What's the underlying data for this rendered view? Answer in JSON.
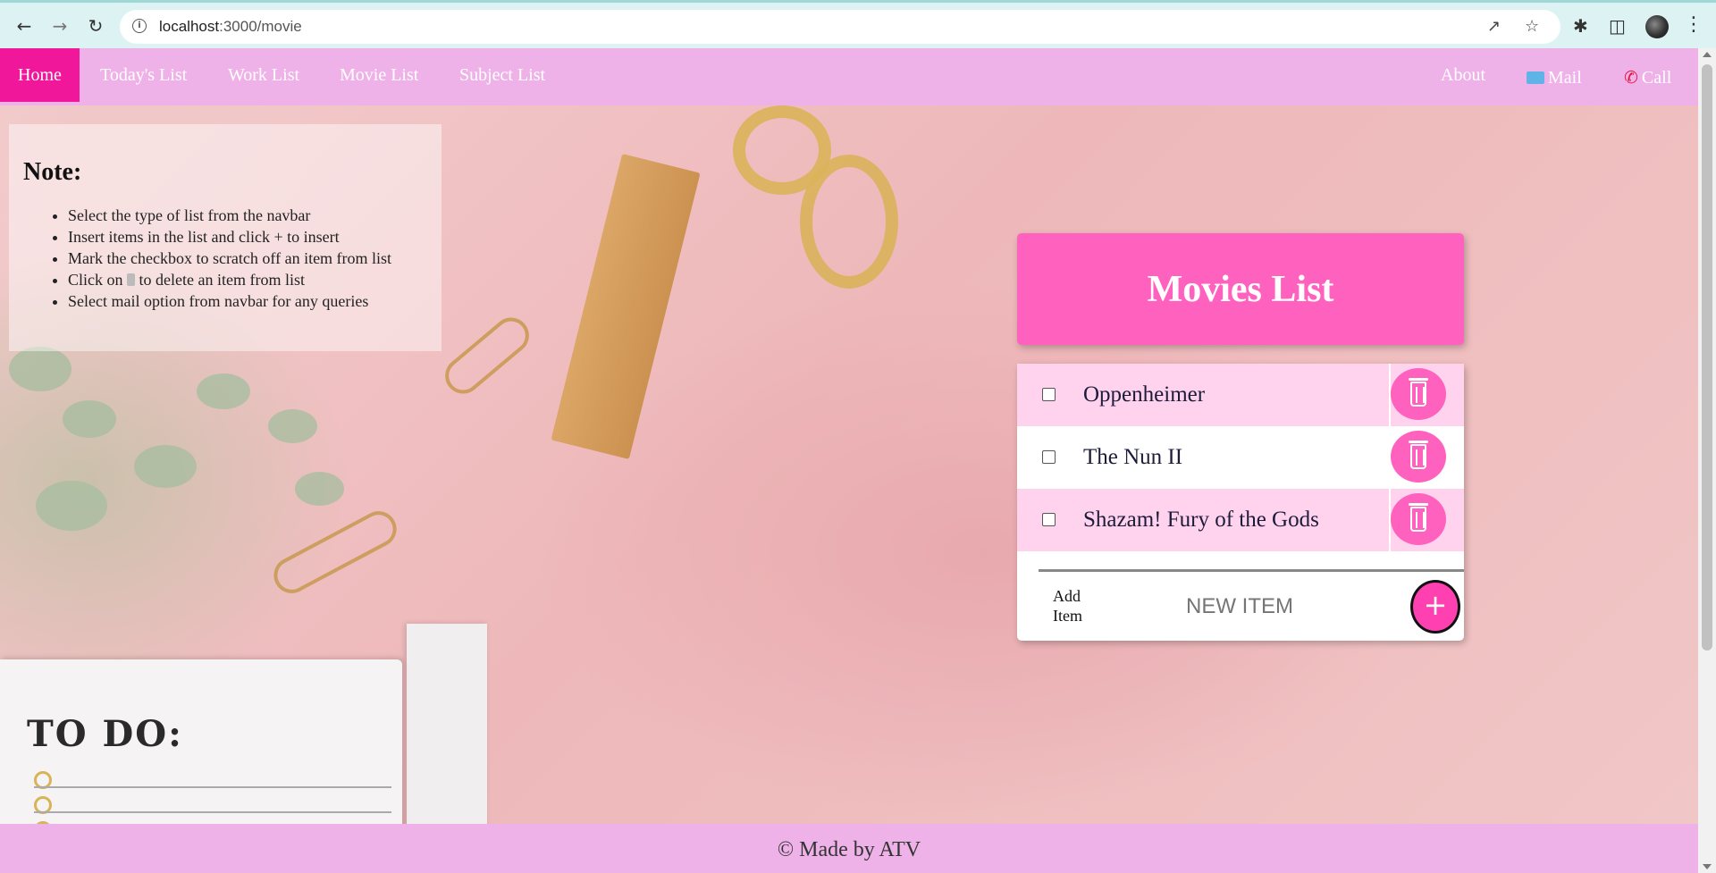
{
  "browser": {
    "url_host": "localhost",
    "url_path": ":3000/movie"
  },
  "navbar": {
    "home": "Home",
    "todays_list": "Today's List",
    "work_list": "Work List",
    "movie_list": "Movie List",
    "subject_list": "Subject List",
    "about": "About",
    "mail": "Mail",
    "call": "Call"
  },
  "note": {
    "title": "Note:",
    "items": [
      "Select the type of list from the navbar",
      "Insert items in the list and click + to insert",
      "Mark the checkbox to scratch off an item from list",
      "to delete an item from list",
      "Select mail option from navbar for any queries"
    ],
    "click_on": "Click on"
  },
  "background": {
    "todo_title": "TO DO:"
  },
  "list": {
    "title": "Movies List",
    "items": [
      {
        "name": "Oppenheimer",
        "checked": false
      },
      {
        "name": "The Nun II",
        "checked": false
      },
      {
        "name": "Shazam! Fury of the Gods",
        "checked": false
      }
    ],
    "add_label": "Add Item",
    "new_item_placeholder": "NEW ITEM",
    "add_button": "+"
  },
  "footer": {
    "text": "© Made by ATV"
  },
  "colors": {
    "navbar": "#efb2e8",
    "active_nav": "#f0179a",
    "accent": "#ff61be",
    "alt_row": "#ffd2ed"
  }
}
